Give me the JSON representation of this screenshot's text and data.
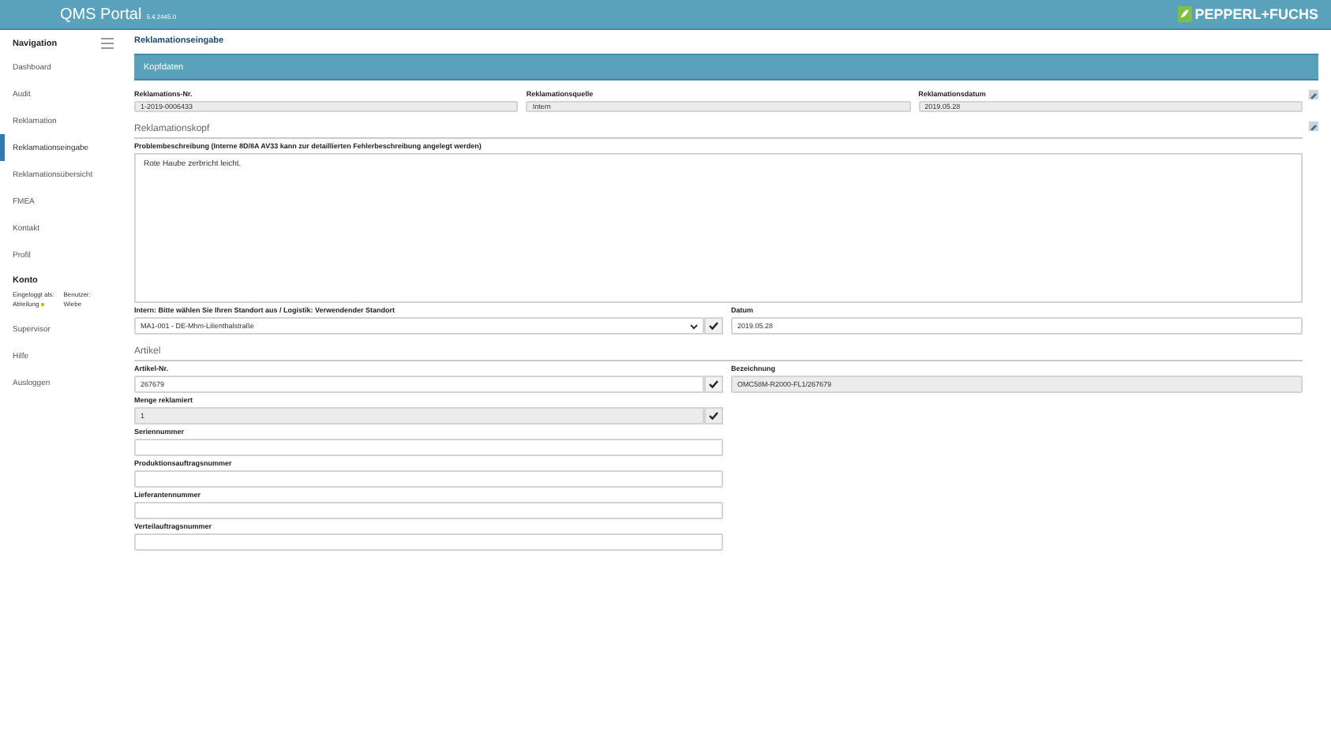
{
  "header": {
    "title": "QMS Portal",
    "version": "5.4.2445.0",
    "brand": "PEPPERL+FUCHS"
  },
  "sidebar": {
    "heading": "Navigation",
    "items": [
      {
        "label": "Dashboard",
        "selected": false
      },
      {
        "label": "Audit",
        "selected": false
      },
      {
        "label": "Reklamation",
        "selected": false
      },
      {
        "label": "Reklamationseingabe",
        "selected": true
      },
      {
        "label": "Reklamationsübersicht",
        "selected": false
      },
      {
        "label": "FMEA",
        "selected": false
      },
      {
        "label": "Kontakt",
        "selected": false
      },
      {
        "label": "Profil",
        "selected": false
      }
    ],
    "account_heading": "Konto",
    "account_info": [
      {
        "label": "Eingeloggt als:",
        "value": "Abteilung"
      },
      {
        "label": "Benutzer:",
        "value": "Wiebe"
      }
    ],
    "bottom_items": [
      "Supervisor",
      "Hilfe",
      "Ausloggen"
    ]
  },
  "page_title": "Reklamationseingabe",
  "panel_title": "Kopfdaten",
  "head_fields": [
    {
      "label": "Reklamations-Nr.",
      "value": "1-2019-0006433",
      "disabled": true
    },
    {
      "label": "Reklamationsquelle",
      "value": "Intern",
      "disabled": true
    },
    {
      "label": "Reklamationsdatum",
      "value": "2019.05.28",
      "disabled": true
    }
  ],
  "section_head": "Reklamationskopf",
  "problem": {
    "label": "Problembeschreibung (Interne 8D/8A AV33 kann zur detaillierten Fehlerbeschreibung angelegt werden)",
    "value": "Rote Haube zerbricht leicht."
  },
  "location": {
    "label": "Intern: Bitte wählen Sie Ihren Standort aus / Logistik: Verwendender Standort",
    "value": "MA1-001 - DE-Mhm-Lilienthalstraße"
  },
  "date": {
    "label": "Datum",
    "value": "2019.05.28",
    "disabled": false
  },
  "section_article": "Artikel",
  "article_no": {
    "label": "Artikel-Nr.",
    "value": "267679",
    "disabled": false
  },
  "designation": {
    "label": "Bezeichnung",
    "value": "OMC58M-R2000-FL1/267679",
    "disabled": true
  },
  "article_fields": [
    {
      "label": "Menge reklamiert",
      "value": "1",
      "disabled": true,
      "check": true
    },
    {
      "label": "Seriennummer",
      "disabled": false,
      "check": false
    },
    {
      "label": "Produktionsauftragsnummer",
      "disabled": false,
      "check": false
    },
    {
      "label": "Lieferantennummer",
      "disabled": false,
      "check": false
    },
    {
      "label": "Verteilauftragsnummer",
      "disabled": false,
      "check": false
    }
  ]
}
